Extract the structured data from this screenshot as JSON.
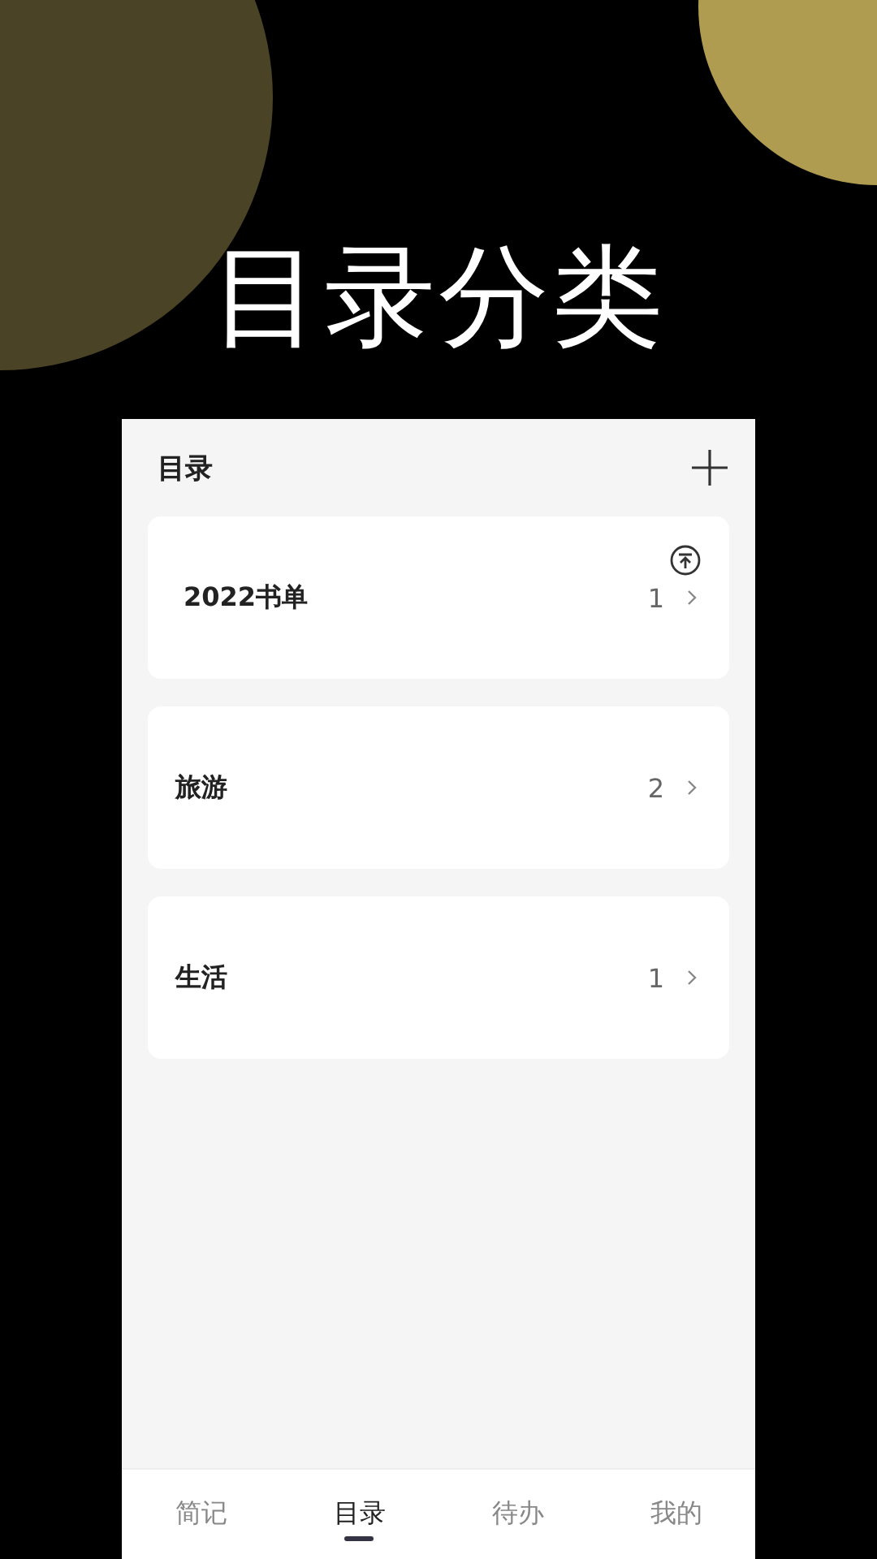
{
  "headline": "目录分类",
  "header": {
    "title": "目录"
  },
  "folders": [
    {
      "name": "2022书单",
      "count": "1",
      "pinned": true
    },
    {
      "name": "旅游",
      "count": "2",
      "pinned": false
    },
    {
      "name": "生活",
      "count": "1",
      "pinned": false
    }
  ],
  "tabs": [
    {
      "label": "简记",
      "selected": false
    },
    {
      "label": "目录",
      "selected": true
    },
    {
      "label": "待办",
      "selected": false
    },
    {
      "label": "我的",
      "selected": false
    }
  ]
}
